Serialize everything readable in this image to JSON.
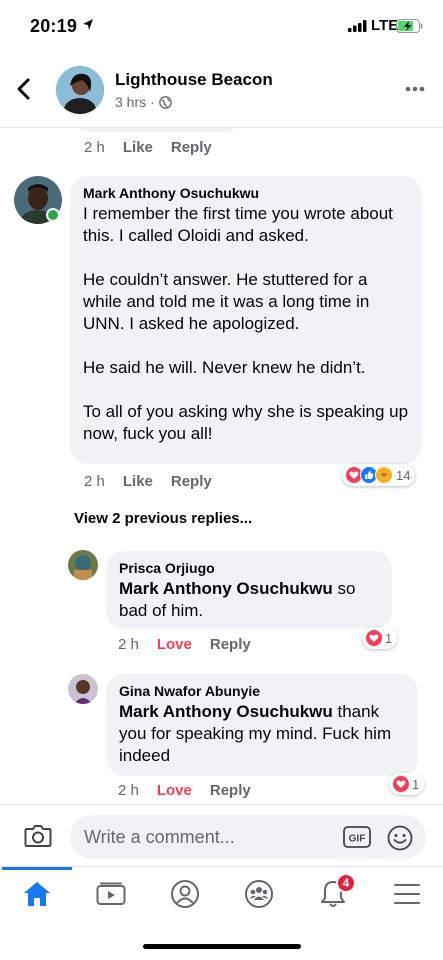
{
  "status_bar": {
    "time": "20:19",
    "network": "LTE"
  },
  "header": {
    "title": "Lighthouse Beacon",
    "subtitle": "3 hrs ·"
  },
  "top_comment_meta": {
    "time": "2 h",
    "like": "Like",
    "reply": "Reply"
  },
  "main_comment": {
    "author": "Mark Anthony Osuchukwu",
    "text": "I remember the first time you wrote about this. I called Oloidi and asked.\n\nHe couldn’t answer. He stuttered for a while and told me it was a long time in UNN. I asked he apologized.\n\nHe said he will. Never knew he didn’t.\n\nTo all of you asking why she is speaking up now, fuck you all!",
    "time": "2 h",
    "like": "Like",
    "reply": "Reply",
    "reaction_count": "14"
  },
  "view_previous": "View 2 previous replies...",
  "replies": [
    {
      "author": "Prisca Orjiugo",
      "mention": "Mark Anthony Osuchukwu",
      "text": " so bad of him.",
      "time": "2 h",
      "reaction": "Love",
      "reply": "Reply",
      "reaction_count": "1"
    },
    {
      "author": "Gina Nwafor Abunyie",
      "mention": "Mark Anthony Osuchukwu",
      "text": " thank you for speaking my mind. Fuck him indeed",
      "time": "2 h",
      "reaction": "Love",
      "reply": "Reply",
      "reaction_count": "1"
    }
  ],
  "composer": {
    "placeholder": "Write a comment...",
    "gif_label": "GIF"
  },
  "tabs": {
    "notifications_badge": "4"
  },
  "colors": {
    "accent": "#1877f2",
    "love": "#f33e58",
    "bubble": "#f0f2f5",
    "badge": "#e41e3f"
  }
}
